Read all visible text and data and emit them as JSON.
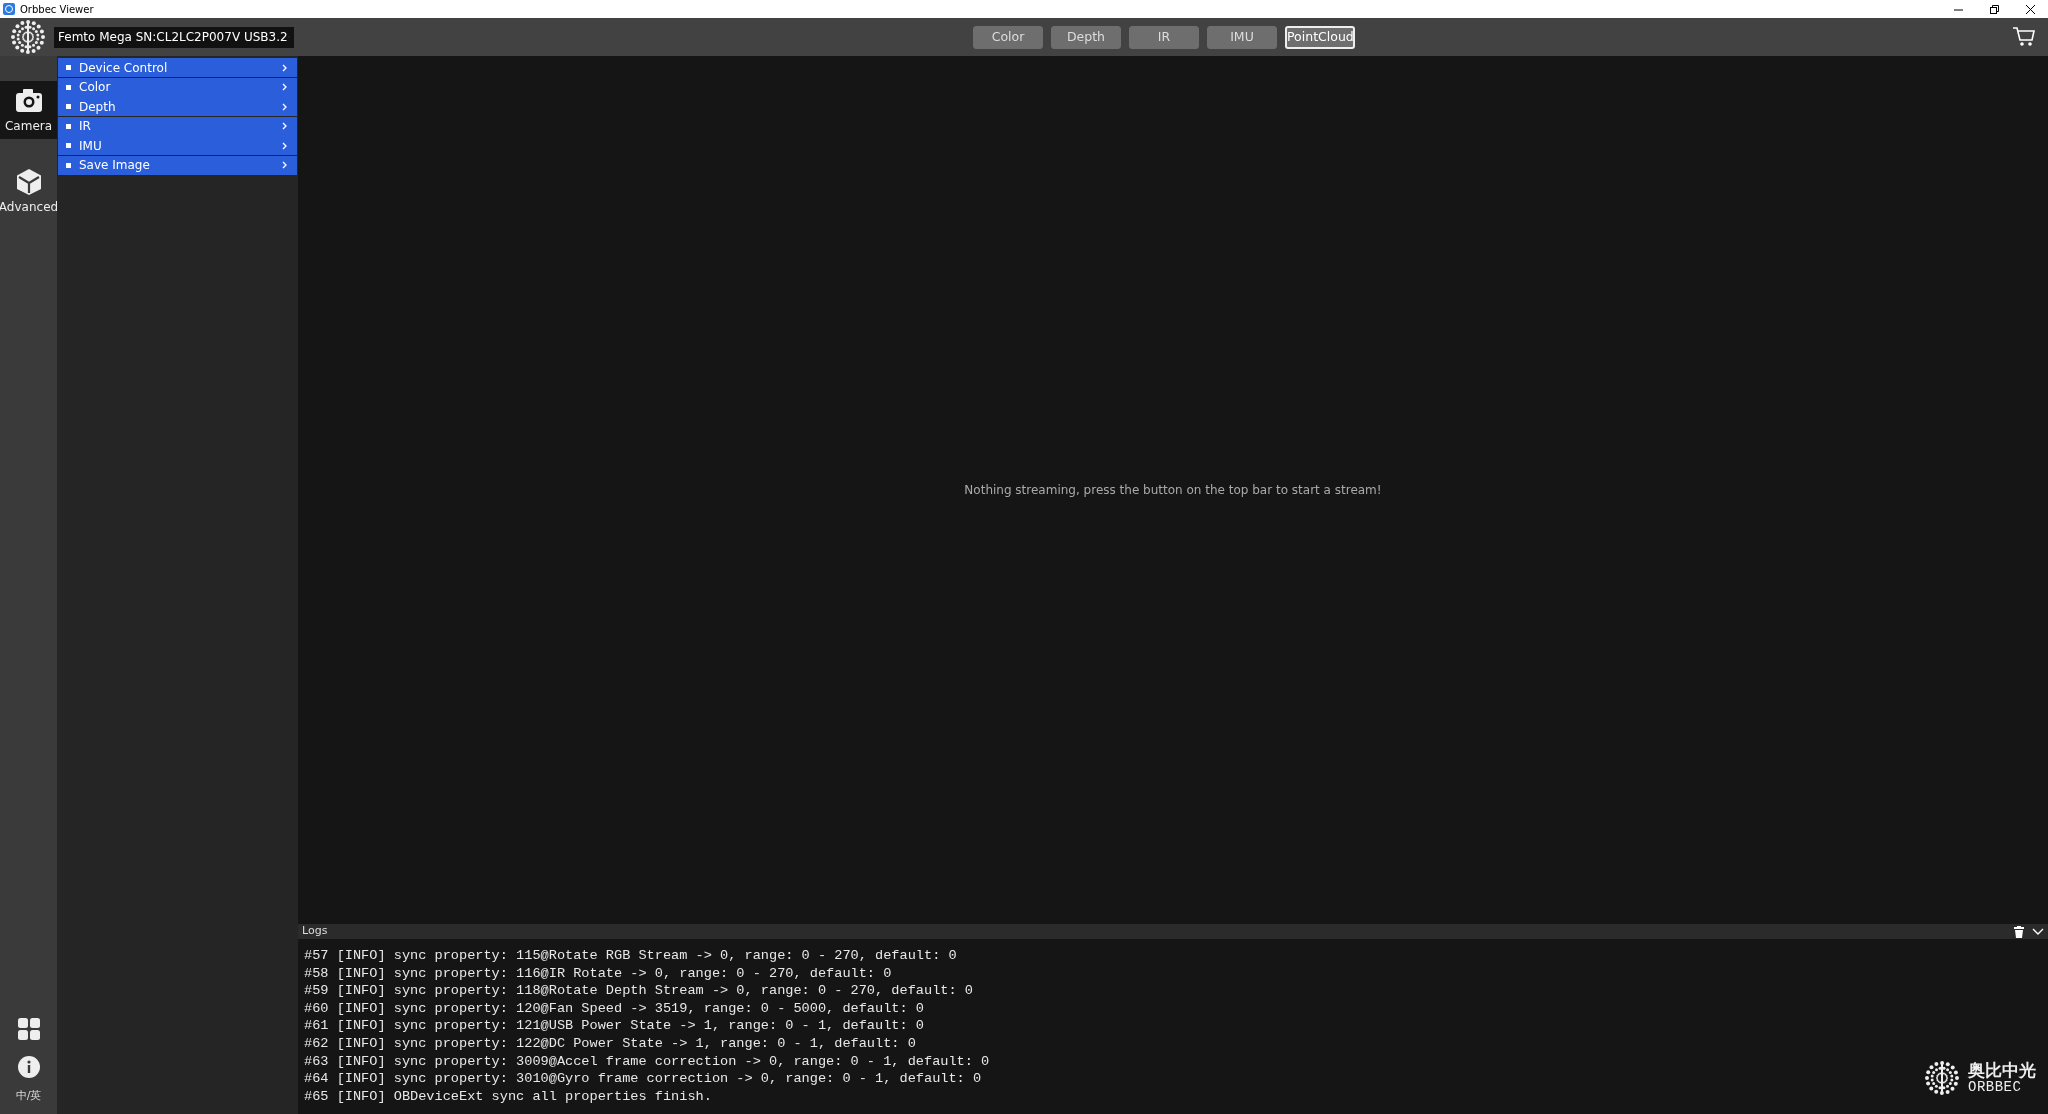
{
  "window": {
    "title": "Orbbec Viewer"
  },
  "device_selector": {
    "value": "Femto Mega SN:CL2LC2P007V USB3.2"
  },
  "stream_buttons": [
    {
      "label": "Color",
      "selected": false
    },
    {
      "label": "Depth",
      "selected": false
    },
    {
      "label": "IR",
      "selected": false
    },
    {
      "label": "IMU",
      "selected": false
    },
    {
      "label": "PointCloud",
      "selected": true
    }
  ],
  "sidebar": {
    "items": [
      {
        "label": "Camera",
        "kind": "camera",
        "selected": true
      },
      {
        "label": "Advanced",
        "kind": "cube",
        "selected": false
      }
    ],
    "language": "中/英"
  },
  "panel": {
    "items": [
      {
        "label": "Device Control"
      },
      {
        "label": "Color"
      },
      {
        "label": "Depth"
      },
      {
        "label": "IR"
      },
      {
        "label": "IMU"
      },
      {
        "label": "Save Image"
      }
    ]
  },
  "viewer": {
    "message": "Nothing streaming, press the button on the top bar to start a stream!"
  },
  "logs": {
    "title": "Logs",
    "lines": [
      "#57 [INFO] sync property: 115@Rotate RGB Stream -> 0, range: 0 - 270, default: 0",
      "#58 [INFO] sync property: 116@IR Rotate -> 0, range: 0 - 270, default: 0",
      "#59 [INFO] sync property: 118@Rotate Depth Stream -> 0, range: 0 - 270, default: 0",
      "#60 [INFO] sync property: 120@Fan Speed -> 3519, range: 0 - 5000, default: 0",
      "#61 [INFO] sync property: 121@USB Power State -> 1, range: 0 - 1, default: 0",
      "#62 [INFO] sync property: 122@DC Power State -> 1, range: 0 - 1, default: 0",
      "#63 [INFO] sync property: 3009@Accel frame correction -> 0, range: 0 - 1, default: 0",
      "#64 [INFO] sync property: 3010@Gyro frame correction -> 0, range: 0 - 1, default: 0",
      "#65 [INFO] OBDeviceExt sync all properties finish."
    ]
  },
  "brand": {
    "chinese": "奥比中光",
    "latin": "ORBBEC"
  }
}
